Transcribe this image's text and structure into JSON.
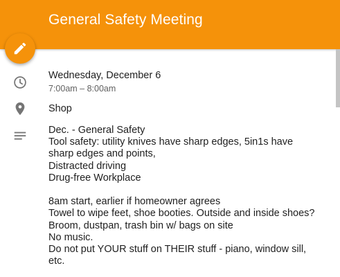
{
  "header": {
    "title": "General Safety Meeting",
    "color": "#f5920a"
  },
  "fab": {
    "icon": "pencil-icon"
  },
  "event": {
    "date": "Wednesday, December 6",
    "time": "7:00am – 8:00am",
    "location": "Shop",
    "description_lines": [
      "Dec. - General Safety",
      "Tool safety: utility knives have sharp edges, 5in1s have sharp edges and points,",
      "Distracted driving",
      "Drug-free Workplace",
      "",
      "8am start, earlier if homeowner agrees",
      "Towel to wipe feet, shoe booties. Outside and inside shoes?",
      "Broom, dustpan, trash bin w/ bags on site",
      "No music.",
      "Do not put YOUR stuff on THEIR stuff - piano, window sill, etc."
    ]
  },
  "icons": {
    "time": "clock-icon",
    "location": "location-pin-icon",
    "description": "notes-icon"
  }
}
